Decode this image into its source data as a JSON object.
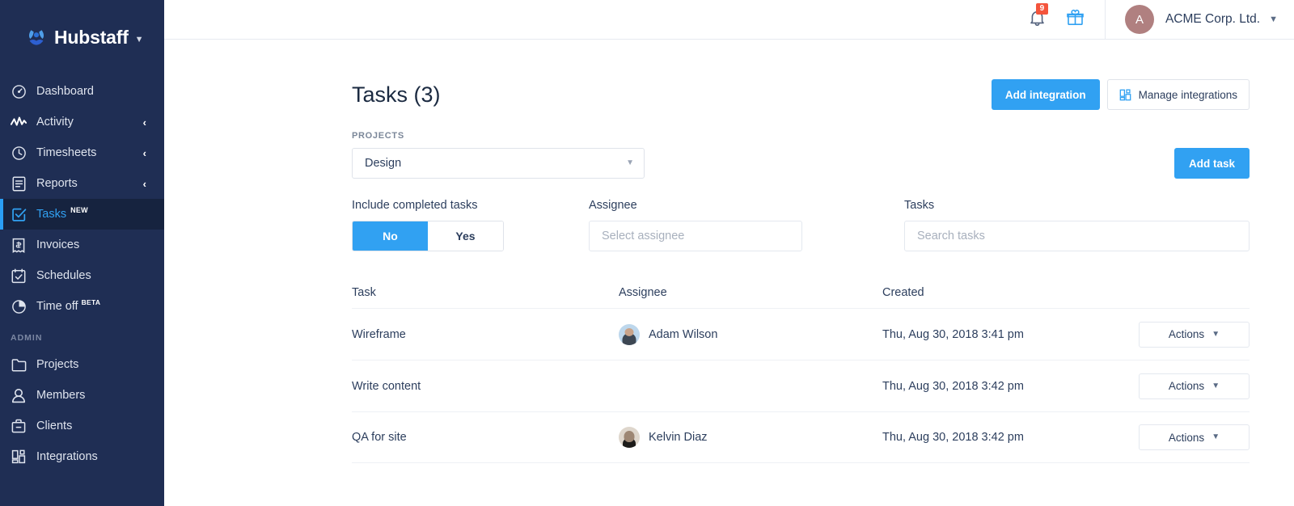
{
  "brand": {
    "name": "Hubstaff",
    "logo_icon": "hubstaff-logo-icon",
    "caret_icon": "chevron-down-icon",
    "sidebar_bg": "#1f2e54",
    "accent": "#31a1f2"
  },
  "sidebar": {
    "items": [
      {
        "label": "Dashboard",
        "icon": "gauge-icon",
        "chevron": "",
        "active": false,
        "tag": ""
      },
      {
        "label": "Activity",
        "icon": "activity-pulse-icon",
        "chevron": "‹",
        "active": false,
        "tag": ""
      },
      {
        "label": "Timesheets",
        "icon": "clock-icon",
        "chevron": "‹",
        "active": false,
        "tag": ""
      },
      {
        "label": "Reports",
        "icon": "report-document-icon",
        "chevron": "‹",
        "active": false,
        "tag": ""
      },
      {
        "label": "Tasks",
        "icon": "checkbox-task-icon",
        "chevron": "",
        "active": true,
        "tag": "NEW"
      },
      {
        "label": "Invoices",
        "icon": "invoice-receipt-icon",
        "chevron": "",
        "active": false,
        "tag": ""
      },
      {
        "label": "Schedules",
        "icon": "calendar-check-icon",
        "chevron": "",
        "active": false,
        "tag": ""
      },
      {
        "label": "Time off",
        "icon": "pie-clock-icon",
        "chevron": "",
        "active": false,
        "tag": "BETA"
      }
    ],
    "admin_section_title": "ADMIN",
    "admin_items": [
      {
        "label": "Projects",
        "icon": "folder-icon"
      },
      {
        "label": "Members",
        "icon": "person-icon"
      },
      {
        "label": "Clients",
        "icon": "briefcase-icon"
      },
      {
        "label": "Integrations",
        "icon": "blocks-integration-icon"
      }
    ]
  },
  "topbar": {
    "notification_icon": "bell-icon",
    "notification_count": "9",
    "notification_badge_color": "#f4543c",
    "gift_icon": "gift-icon",
    "gift_icon_color": "#31a1f2",
    "account_initial": "A",
    "account_name": "ACME Corp. Ltd.",
    "account_caret_icon": "chevron-down-icon",
    "avatar_color": "#b08080"
  },
  "page": {
    "title": "Tasks (3)",
    "add_integration_label": "Add integration",
    "manage_integrations_label": "Manage integrations",
    "manage_integrations_icon": "blocks-integration-icon"
  },
  "filters": {
    "projects_label": "PROJECTS",
    "projects_value": "Design",
    "projects_caret_icon": "chevron-down-icon",
    "add_task_label": "Add task",
    "include_completed_label": "Include completed tasks",
    "toggle_no": "No",
    "toggle_yes": "Yes",
    "toggle_selected": "No",
    "assignee_label": "Assignee",
    "assignee_value": "",
    "assignee_placeholder": "Select assignee",
    "tasks_label": "Tasks",
    "tasks_search_value": "",
    "tasks_search_placeholder": "Search tasks"
  },
  "table": {
    "columns": {
      "task": "Task",
      "assignee": "Assignee",
      "created": "Created",
      "actions": ""
    },
    "actions_label": "Actions",
    "actions_caret_icon": "chevron-down-icon",
    "rows": [
      {
        "task": "Wireframe",
        "assignee": "Adam Wilson",
        "has_avatar": true,
        "avatar_class": "av-adam",
        "created": "Thu, Aug 30, 2018 3:41 pm"
      },
      {
        "task": "Write content",
        "assignee": "",
        "has_avatar": false,
        "avatar_class": "",
        "created": "Thu, Aug 30, 2018 3:42 pm"
      },
      {
        "task": "QA for site",
        "assignee": "Kelvin Diaz",
        "has_avatar": true,
        "avatar_class": "av-kelvin",
        "created": "Thu, Aug 30, 2018 3:42 pm"
      }
    ]
  }
}
